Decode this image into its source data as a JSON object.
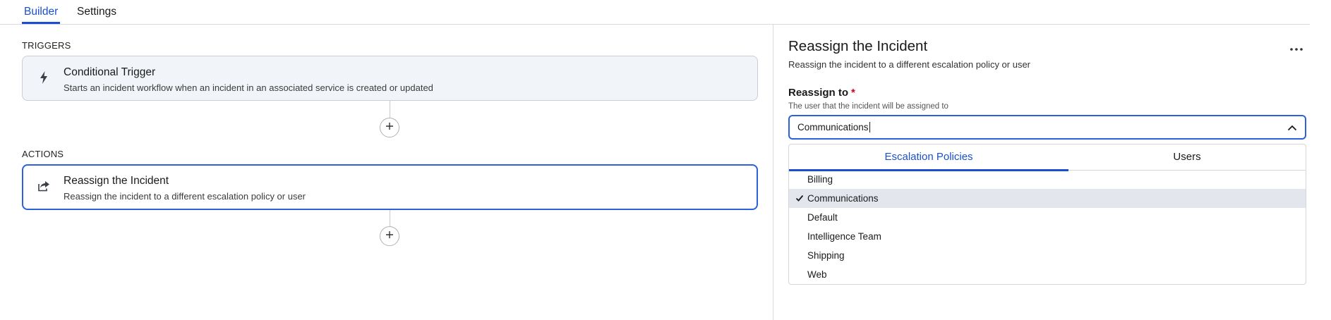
{
  "tabs": {
    "builder": "Builder",
    "settings": "Settings",
    "active": "Builder"
  },
  "canvas": {
    "triggers_label": "TRIGGERS",
    "actions_label": "ACTIONS",
    "trigger_card": {
      "icon": "lightning-bolt-icon",
      "title": "Conditional Trigger",
      "description": "Starts an incident workflow when an incident in an associated service is created or updated"
    },
    "action_card": {
      "icon": "share-arrow-icon",
      "title": "Reassign the Incident",
      "description": "Reassign the incident to a different escalation policy or user",
      "selected": true
    },
    "add_icon": "plus-icon"
  },
  "panel": {
    "title": "Reassign the Incident",
    "subtitle": "Reassign the incident to a different escalation policy or user",
    "more_icon": "ellipsis-icon",
    "field": {
      "label": "Reassign to",
      "required_mark": "*",
      "help": "The user that the incident will be assigned to",
      "value": "Communications",
      "expanded": true
    },
    "dropdown": {
      "tabs": [
        "Escalation Policies",
        "Users"
      ],
      "active_tab": "Escalation Policies",
      "options": [
        "Billing",
        "Communications",
        "Default",
        "Intelligence Team",
        "Shipping",
        "Web"
      ],
      "selected": "Communications"
    }
  },
  "colors": {
    "accent": "#1b4fd1",
    "selected_border": "#2c61d9",
    "card_bg": "#f1f5f9",
    "selected_option_bg": "#e3e6ec",
    "required": "#d0021b"
  }
}
